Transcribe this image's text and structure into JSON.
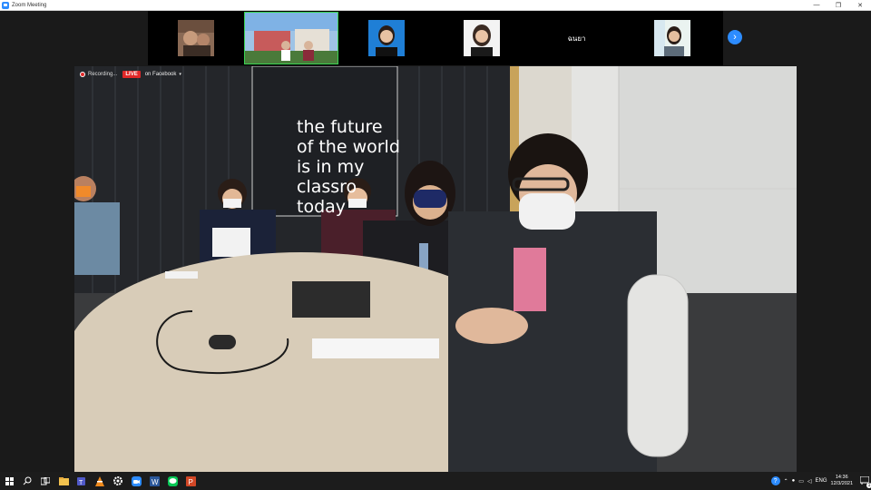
{
  "window": {
    "title": "Zoom Meeting",
    "minimize": "—",
    "restore": "❐",
    "close": "✕"
  },
  "participants": {
    "named_tile": "ฉนยา",
    "next_icon": "chevron-right-icon"
  },
  "recording": {
    "label": "Recording...",
    "live": "LIVE",
    "destination": "on Facebook",
    "caret": "▾"
  },
  "scene": {
    "wall_text": "the future\nof the world\nis in my\nclassro\ntoday"
  },
  "taskbar": {
    "apps": [
      "windows-start-icon",
      "search-icon",
      "task-view-icon",
      "file-explorer-icon",
      "teams-icon",
      "vlc-icon",
      "settings-icon",
      "zoom-icon",
      "word-icon",
      "line-icon",
      "powerpoint-icon"
    ],
    "language": "ENG",
    "time": "14:36",
    "date": "12/3/2021",
    "notifications": "1"
  },
  "colors": {
    "zoom_blue": "#2d8cff",
    "live_red": "#e02828",
    "active_speaker": "#39d353"
  }
}
